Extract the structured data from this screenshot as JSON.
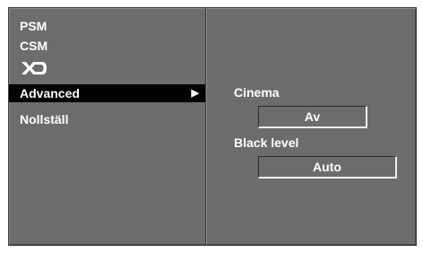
{
  "menu": {
    "items": [
      {
        "label": "PSM"
      },
      {
        "label": "CSM"
      },
      {
        "logo": "XD"
      },
      {
        "label": "Advanced",
        "arrow": "▶",
        "selected": true
      },
      {
        "label": "Nollställ"
      }
    ]
  },
  "submenu": {
    "cinema_label": "Cinema",
    "cinema_value": "Av",
    "black_level_label": "Black level",
    "black_level_value": "Auto"
  },
  "colors": {
    "panel_bg": "#6c6c6c",
    "highlight_bg": "#000000",
    "text": "#ffffff"
  }
}
